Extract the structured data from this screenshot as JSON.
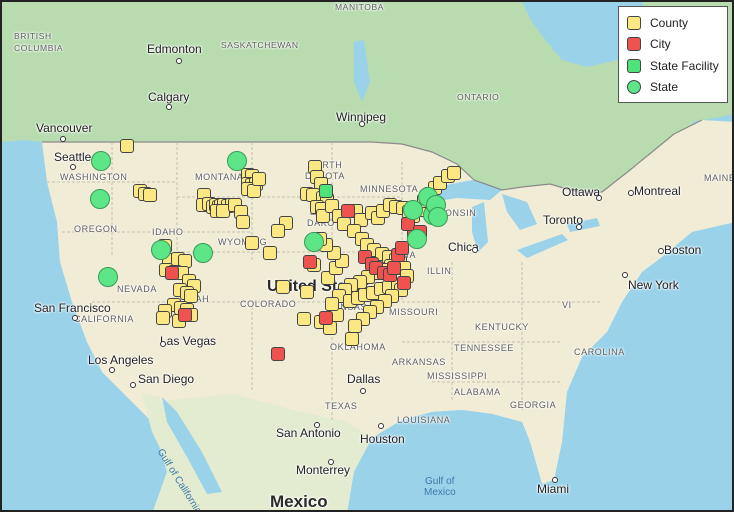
{
  "legend": [
    {
      "label": "County",
      "color": "#fce883",
      "shape": "square"
    },
    {
      "label": "City",
      "color": "#ef5350",
      "shape": "square"
    },
    {
      "label": "State Facility",
      "color": "#4ee27a",
      "shape": "square"
    },
    {
      "label": "State",
      "color": "#5ce687",
      "shape": "circle"
    }
  ],
  "labels": {
    "manitoba": "MANITOBA",
    "british_columbia": "BRITISH COLUMBIA",
    "saskatchewan": "SASKATCHEWAN",
    "edmonton": "Edmonton",
    "calgary": "Calgary",
    "ontario": "ONTARIO",
    "winnipeg": "Winnipeg",
    "vancouver": "Vancouver",
    "seattle": "Seattle",
    "washington": "WASHINGTON",
    "montana": "MONTANA",
    "north_dakota": "NORTH DAKOTA",
    "minnesota": "MINNESOTA",
    "ottawa": "Ottawa",
    "montreal": "Montreal",
    "maine": "MAINE",
    "oregon": "OREGON",
    "idaho": "IDAHO",
    "wyoming": "WYOMING",
    "south_dakota": "SOUTH DAKOTA",
    "wisconsin": "WISCONSIN",
    "toronto": "Toronto",
    "boston": "Boston",
    "chicago": "Chica",
    "iowa": "IOWA",
    "illinois": "ILLIN",
    "nevada": "NEVADA",
    "utah": "UTAH",
    "united_states": "United States",
    "colorado": "COLORADO",
    "new_york": "New York",
    "san_francisco": "San Francisco",
    "california": "CALIFORNIA",
    "kansas": "KANSAS",
    "missouri": "MISSOURI",
    "kentucky": "KENTUCKY",
    "las_vegas": "Las Vegas",
    "virginia": "VI",
    "oklahoma": "OKLAHOMA",
    "tennessee": "TENNESSEE",
    "carolina": "CAROLINA",
    "los_angeles": "Los Angeles",
    "arkansas": "ARKANSAS",
    "dallas": "Dallas",
    "san_diego": "San Diego",
    "mississippi": "MISSISSIPPI",
    "alabama": "ALABAMA",
    "texas": "TEXAS",
    "georgia": "GEORGIA",
    "louisiana": "LOUISIANA",
    "san_antonio": "San Antonio",
    "houston": "Houston",
    "gulf_of_california": "Gulf of California",
    "gulf_of_mexico_1": "Gulf of",
    "gulf_of_mexico_2": "Mexico",
    "monterrey": "Monterrey",
    "miami": "Miami",
    "mexico": "Mexico"
  },
  "markers": [
    {
      "type": "county",
      "lon": -116.6,
      "lat": 48.7
    },
    {
      "type": "county",
      "lon": -114.7,
      "lat": 44.6
    },
    {
      "type": "county",
      "lon": -114.0,
      "lat": 44.4
    },
    {
      "type": "county",
      "lon": -113.3,
      "lat": 44.3
    },
    {
      "type": "county",
      "lon": -105.4,
      "lat": 44.3
    },
    {
      "type": "county",
      "lon": -105.5,
      "lat": 43.4
    },
    {
      "type": "county",
      "lon": -104.6,
      "lat": 43.5
    },
    {
      "type": "county",
      "lon": -104.1,
      "lat": 43.2
    },
    {
      "type": "county",
      "lon": -103.6,
      "lat": 43.4
    },
    {
      "type": "county",
      "lon": -103.2,
      "lat": 43.2
    },
    {
      "type": "county",
      "lon": -102.9,
      "lat": 43.3
    },
    {
      "type": "county",
      "lon": -102.4,
      "lat": 43.4
    },
    {
      "type": "county",
      "lon": -101.9,
      "lat": 43.3
    },
    {
      "type": "county",
      "lon": -101.3,
      "lat": 43.4
    },
    {
      "type": "county",
      "lon": -103.4,
      "lat": 42.8
    },
    {
      "type": "county",
      "lon": -102.6,
      "lat": 42.8
    },
    {
      "type": "county",
      "lon": -100.9,
      "lat": 43.4
    },
    {
      "type": "county",
      "lon": -99.9,
      "lat": 42.7
    },
    {
      "type": "county",
      "lon": -99.7,
      "lat": 41.8
    },
    {
      "type": "county",
      "lon": -98.3,
      "lat": 39.9
    },
    {
      "type": "county",
      "lon": -98.9,
      "lat": 46.1
    },
    {
      "type": "county",
      "lon": -98.3,
      "lat": 46.0
    },
    {
      "type": "county",
      "lon": -99.0,
      "lat": 45.3
    },
    {
      "type": "county",
      "lon": -98.4,
      "lat": 45.2
    },
    {
      "type": "county",
      "lon": -97.8,
      "lat": 45.3
    },
    {
      "type": "county",
      "lon": -98.9,
      "lat": 44.8
    },
    {
      "type": "county",
      "lon": -98.1,
      "lat": 44.6
    },
    {
      "type": "county",
      "lon": -97.4,
      "lat": 45.7
    },
    {
      "type": "county",
      "lon": -89.2,
      "lat": 46.8
    },
    {
      "type": "county",
      "lon": -88.9,
      "lat": 45.9
    },
    {
      "type": "county",
      "lon": -88.3,
      "lat": 45.3
    },
    {
      "type": "county",
      "lon": -90.3,
      "lat": 44.4
    },
    {
      "type": "county",
      "lon": -89.5,
      "lat": 44.3
    },
    {
      "type": "county",
      "lon": -88.0,
      "lat": 44.0
    },
    {
      "type": "county",
      "lon": -87.4,
      "lat": 43.8
    },
    {
      "type": "county",
      "lon": -88.8,
      "lat": 43.2
    },
    {
      "type": "county",
      "lon": -88.1,
      "lat": 43.0
    },
    {
      "type": "county",
      "lon": -88.0,
      "lat": 42.4
    },
    {
      "type": "county",
      "lon": -86.7,
      "lat": 43.3
    },
    {
      "type": "county",
      "lon": -85.6,
      "lat": 42.4
    },
    {
      "type": "county",
      "lon": -84.9,
      "lat": 41.6
    },
    {
      "type": "county",
      "lon": -83.1,
      "lat": 42.8
    },
    {
      "type": "county",
      "lon": -82.4,
      "lat": 42.0
    },
    {
      "type": "county",
      "lon": -80.8,
      "lat": 42.6
    },
    {
      "type": "county",
      "lon": -80.0,
      "lat": 42.2
    },
    {
      "type": "county",
      "lon": -79.2,
      "lat": 42.8
    },
    {
      "type": "county",
      "lon": -78.2,
      "lat": 43.4
    },
    {
      "type": "county",
      "lon": -77.3,
      "lat": 43.2
    },
    {
      "type": "county",
      "lon": -76.3,
      "lat": 43.1
    },
    {
      "type": "county",
      "lon": -75.4,
      "lat": 42.7
    },
    {
      "type": "county",
      "lon": -74.8,
      "lat": 42.4
    },
    {
      "type": "county",
      "lon": -74.0,
      "lat": 42.9
    },
    {
      "type": "county",
      "lon": -73.2,
      "lat": 43.7
    },
    {
      "type": "county",
      "lon": -72.4,
      "lat": 44.4
    },
    {
      "type": "county",
      "lon": -71.6,
      "lat": 44.9
    },
    {
      "type": "county",
      "lon": -70.9,
      "lat": 45.4
    },
    {
      "type": "county",
      "lon": -69.7,
      "lat": 46.0
    },
    {
      "type": "county",
      "lon": -68.8,
      "lat": 46.3
    },
    {
      "type": "county",
      "lon": -83.4,
      "lat": 41.0
    },
    {
      "type": "county",
      "lon": -82.3,
      "lat": 40.3
    },
    {
      "type": "county",
      "lon": -81.6,
      "lat": 39.7
    },
    {
      "type": "county",
      "lon": -80.5,
      "lat": 39.3
    },
    {
      "type": "county",
      "lon": -79.4,
      "lat": 38.9
    },
    {
      "type": "county",
      "lon": -78.3,
      "lat": 38.6
    },
    {
      "type": "county",
      "lon": -77.4,
      "lat": 38.4
    },
    {
      "type": "county",
      "lon": -76.8,
      "lat": 38.1
    },
    {
      "type": "county",
      "lon": -76.2,
      "lat": 37.6
    },
    {
      "type": "county",
      "lon": -75.7,
      "lat": 36.9
    },
    {
      "type": "county",
      "lon": -78.0,
      "lat": 37.8
    },
    {
      "type": "county",
      "lon": -79.2,
      "lat": 37.5
    },
    {
      "type": "county",
      "lon": -80.3,
      "lat": 37.2
    },
    {
      "type": "county",
      "lon": -81.4,
      "lat": 36.8
    },
    {
      "type": "county",
      "lon": -82.6,
      "lat": 36.4
    },
    {
      "type": "county",
      "lon": -83.9,
      "lat": 36.1
    },
    {
      "type": "county",
      "lon": -84.8,
      "lat": 35.6
    },
    {
      "type": "county",
      "lon": -85.7,
      "lat": 35.1
    },
    {
      "type": "county",
      "lon": -84.1,
      "lat": 34.6
    },
    {
      "type": "county",
      "lon": -82.9,
      "lat": 34.9
    },
    {
      "type": "county",
      "lon": -81.8,
      "lat": 35.2
    },
    {
      "type": "county",
      "lon": -80.7,
      "lat": 35.4
    },
    {
      "type": "county",
      "lon": -79.5,
      "lat": 35.7
    },
    {
      "type": "county",
      "lon": -78.4,
      "lat": 35.9
    },
    {
      "type": "county",
      "lon": -77.1,
      "lat": 36.1
    },
    {
      "type": "county",
      "lon": -76.6,
      "lat": 35.6
    },
    {
      "type": "county",
      "lon": -77.9,
      "lat": 35.1
    },
    {
      "type": "county",
      "lon": -79.0,
      "lat": 34.6
    },
    {
      "type": "county",
      "lon": -80.1,
      "lat": 34.1
    },
    {
      "type": "county",
      "lon": -81.1,
      "lat": 33.6
    },
    {
      "type": "county",
      "lon": -82.2,
      "lat": 33.0
    },
    {
      "type": "county",
      "lon": -83.3,
      "lat": 32.4
    },
    {
      "type": "county",
      "lon": -83.8,
      "lat": 31.2
    },
    {
      "type": "county",
      "lon": -85.9,
      "lat": 33.4
    },
    {
      "type": "county",
      "lon": -86.7,
      "lat": 34.4
    },
    {
      "type": "county",
      "lon": -87.2,
      "lat": 36.7
    },
    {
      "type": "county",
      "lon": -86.1,
      "lat": 37.6
    },
    {
      "type": "county",
      "lon": -85.2,
      "lat": 38.3
    },
    {
      "type": "county",
      "lon": -86.4,
      "lat": 39.0
    },
    {
      "type": "county",
      "lon": -87.5,
      "lat": 39.7
    },
    {
      "type": "county",
      "lon": -88.4,
      "lat": 40.3
    },
    {
      "type": "county",
      "lon": -89.3,
      "lat": 37.9
    },
    {
      "type": "county",
      "lon": -90.3,
      "lat": 35.5
    },
    {
      "type": "county",
      "lon": -93.4,
      "lat": 41.7
    },
    {
      "type": "county",
      "lon": -94.6,
      "lat": 41.0
    },
    {
      "type": "county",
      "lon": -95.7,
      "lat": 39.0
    },
    {
      "type": "county",
      "lon": -111.1,
      "lat": 39.6
    },
    {
      "type": "county",
      "lon": -110.4,
      "lat": 38.4
    },
    {
      "type": "county",
      "lon": -109.2,
      "lat": 38.5
    },
    {
      "type": "county",
      "lon": -108.1,
      "lat": 38.3
    },
    {
      "type": "county",
      "lon": -110.9,
      "lat": 37.5
    },
    {
      "type": "county",
      "lon": -109.6,
      "lat": 37.3
    },
    {
      "type": "county",
      "lon": -108.5,
      "lat": 37.2
    },
    {
      "type": "county",
      "lon": -107.6,
      "lat": 36.5
    },
    {
      "type": "county",
      "lon": -106.8,
      "lat": 36.0
    },
    {
      "type": "county",
      "lon": -108.9,
      "lat": 35.6
    },
    {
      "type": "county",
      "lon": -107.9,
      "lat": 35.4
    },
    {
      "type": "county",
      "lon": -107.2,
      "lat": 35.1
    },
    {
      "type": "county",
      "lon": -109.8,
      "lat": 34.3
    },
    {
      "type": "county",
      "lon": -108.7,
      "lat": 34.0
    },
    {
      "type": "county",
      "lon": -107.9,
      "lat": 33.8
    },
    {
      "type": "county",
      "lon": -107.3,
      "lat": 33.4
    },
    {
      "type": "county",
      "lon": -111.0,
      "lat": 33.7
    },
    {
      "type": "county",
      "lon": -111.4,
      "lat": 33.1
    },
    {
      "type": "county",
      "lon": -109.0,
      "lat": 32.8
    },
    {
      "type": "county",
      "lon": -90.8,
      "lat": 33.0
    },
    {
      "type": "county",
      "lon": -88.3,
      "lat": 32.7
    },
    {
      "type": "county",
      "lon": -87.0,
      "lat": 32.2
    },
    {
      "type": "county",
      "lon": -93.8,
      "lat": 35.9
    },
    {
      "type": "city",
      "lon": -84.3,
      "lat": 42.8
    },
    {
      "type": "city",
      "lon": -89.9,
      "lat": 38.2
    },
    {
      "type": "city",
      "lon": -81.9,
      "lat": 38.6
    },
    {
      "type": "city",
      "lon": -80.8,
      "lat": 38.0
    },
    {
      "type": "city",
      "lon": -80.2,
      "lat": 37.6
    },
    {
      "type": "city",
      "lon": -79.1,
      "lat": 37.2
    },
    {
      "type": "city",
      "lon": -78.2,
      "lat": 37.0
    },
    {
      "type": "city",
      "lon": -77.6,
      "lat": 37.6
    },
    {
      "type": "city",
      "lon": -77.0,
      "lat": 38.8
    },
    {
      "type": "city",
      "lon": -76.4,
      "lat": 39.5
    },
    {
      "type": "city",
      "lon": -74.7,
      "lat": 40.7
    },
    {
      "type": "city",
      "lon": -75.6,
      "lat": 41.6
    },
    {
      "type": "city",
      "lon": -73.8,
      "lat": 40.9
    },
    {
      "type": "city",
      "lon": -76.1,
      "lat": 36.3
    },
    {
      "type": "city",
      "lon": -87.6,
      "lat": 33.1
    },
    {
      "type": "city",
      "lon": -110.0,
      "lat": 37.2
    },
    {
      "type": "city",
      "lon": -108.2,
      "lat": 33.4
    },
    {
      "type": "city",
      "lon": -94.5,
      "lat": 29.8
    },
    {
      "type": "facility",
      "lon": -87.5,
      "lat": 44.6
    },
    {
      "type": "state",
      "lon": -120.4,
      "lat": 47.4
    },
    {
      "type": "state",
      "lon": -120.6,
      "lat": 43.9
    },
    {
      "type": "state",
      "lon": -119.4,
      "lat": 36.8
    },
    {
      "type": "state",
      "lon": -111.6,
      "lat": 39.3
    },
    {
      "type": "state",
      "lon": -105.5,
      "lat": 39.0
    },
    {
      "type": "state",
      "lon": -100.5,
      "lat": 47.4
    },
    {
      "type": "state",
      "lon": -89.3,
      "lat": 40.0
    },
    {
      "type": "state",
      "lon": -74.9,
      "lat": 42.9
    },
    {
      "type": "state",
      "lon": -72.7,
      "lat": 44.1
    },
    {
      "type": "state",
      "lon": -72.0,
      "lat": 42.5
    },
    {
      "type": "state",
      "lon": -71.5,
      "lat": 43.4
    },
    {
      "type": "state",
      "lon": -71.2,
      "lat": 42.3
    },
    {
      "type": "state",
      "lon": -74.2,
      "lat": 40.3
    }
  ]
}
